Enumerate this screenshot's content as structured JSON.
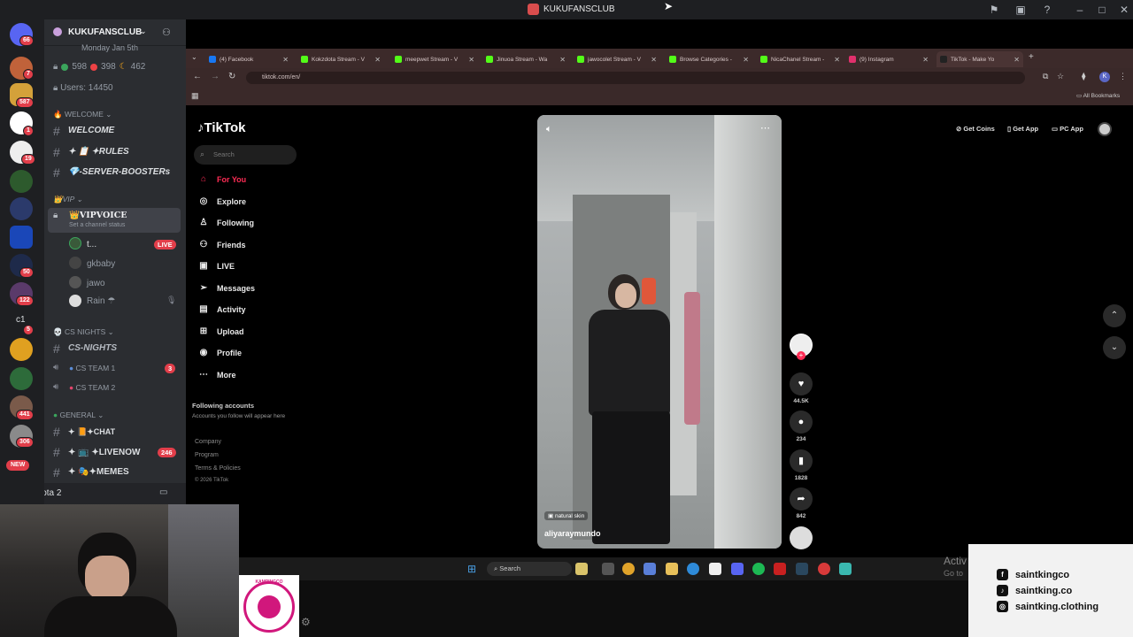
{
  "window": {
    "title": "KUKUFANSCLUB"
  },
  "rail": {
    "badges": [
      "66",
      "7",
      "587",
      "1",
      "19",
      "50",
      "122",
      "5",
      "441",
      "306"
    ],
    "new_label": "NEW",
    "text_server": "c1"
  },
  "channels": {
    "server_name": "KUKUFANSCLUB",
    "event_date": "Monday Jan 5th",
    "stats": {
      "online": "598",
      "dnd": "398",
      "idle": "462"
    },
    "users": "Users: 14450",
    "cat_welcome": "WELCOME",
    "ch_welcome": "WELCOME",
    "ch_rules": "✦RULES",
    "ch_boosters": "-SERVER-BOOSTERs",
    "cat_vip": "VIP",
    "ch_vipvoice": "VIPVOICE",
    "vip_status": "Set a channel status",
    "voice_users": [
      {
        "name": "t...",
        "live": "LIVE"
      },
      {
        "name": "gkbaby"
      },
      {
        "name": "jawo"
      },
      {
        "name": "Rain ☂"
      }
    ],
    "cat_cs": "CS NIGHTS",
    "ch_csnights": "CS-NIGHTS",
    "ch_csteam1": "CS TEAM 1",
    "csteam1_count": "3",
    "ch_csteam2": "CS TEAM 2",
    "cat_general": "GENERAL",
    "ch_chat": "✦CHAT",
    "ch_livenow": "✦LIVENOW",
    "livenow_count": "246",
    "ch_memes": "✦MEMES",
    "game_activity": "Dota 2"
  },
  "browser": {
    "tabs": [
      {
        "label": "(4) Facebook",
        "color": "#1877f2"
      },
      {
        "label": "Kokzdota Stream - V",
        "color": "#53fc18"
      },
      {
        "label": "meepwet Stream - V",
        "color": "#53fc18"
      },
      {
        "label": "Jinuoa Stream - Wa",
        "color": "#53fc18"
      },
      {
        "label": "jawocolet Stream - V",
        "color": "#53fc18"
      },
      {
        "label": "Browse Categories -",
        "color": "#53fc18"
      },
      {
        "label": "NicaChanel Stream -",
        "color": "#53fc18"
      },
      {
        "label": "(9) Instagram",
        "color": "#e1306c"
      },
      {
        "label": "TikTok - Make Yo",
        "color": "#222222"
      }
    ],
    "url": "tiktok.com/en/",
    "bookmarks_label": "All Bookmarks"
  },
  "tiktok": {
    "logo": "TikTok",
    "search_placeholder": "Search",
    "nav": [
      {
        "label": "For You",
        "icon": "home-icon",
        "active": true
      },
      {
        "label": "Explore",
        "icon": "compass-icon"
      },
      {
        "label": "Following",
        "icon": "following-icon"
      },
      {
        "label": "Friends",
        "icon": "friends-icon"
      },
      {
        "label": "LIVE",
        "icon": "live-icon"
      },
      {
        "label": "Messages",
        "icon": "messages-icon"
      },
      {
        "label": "Activity",
        "icon": "activity-icon"
      },
      {
        "label": "Upload",
        "icon": "upload-icon"
      },
      {
        "label": "Profile",
        "icon": "profile-icon"
      },
      {
        "label": "More",
        "icon": "more-icon"
      }
    ],
    "following_title": "Following accounts",
    "following_sub": "Accounts you follow will appear here",
    "footer": [
      "Company",
      "Program",
      "Terms & Policies",
      "© 2026 TikTok"
    ],
    "top_buttons": {
      "coins": "Get Coins",
      "app": "Get App",
      "pc": "PC App"
    },
    "video": {
      "tag": "natural skin",
      "author": "aliyaraymundo"
    },
    "actions": {
      "likes": "44.5K",
      "comments": "234",
      "saves": "1828",
      "shares": "842"
    }
  },
  "taskbar": {
    "search_placeholder": "Search",
    "activate_text": "Activ",
    "activate_sub": "Go to"
  },
  "social": [
    {
      "icon": "facebook-icon",
      "glyph": "f",
      "handle": "saintkingco"
    },
    {
      "icon": "tiktok-icon",
      "glyph": "♪",
      "handle": "saintking.co"
    },
    {
      "icon": "instagram-icon",
      "glyph": "◎",
      "handle": "saintking.clothing"
    }
  ],
  "logo_text": "KAMPINGCO"
}
